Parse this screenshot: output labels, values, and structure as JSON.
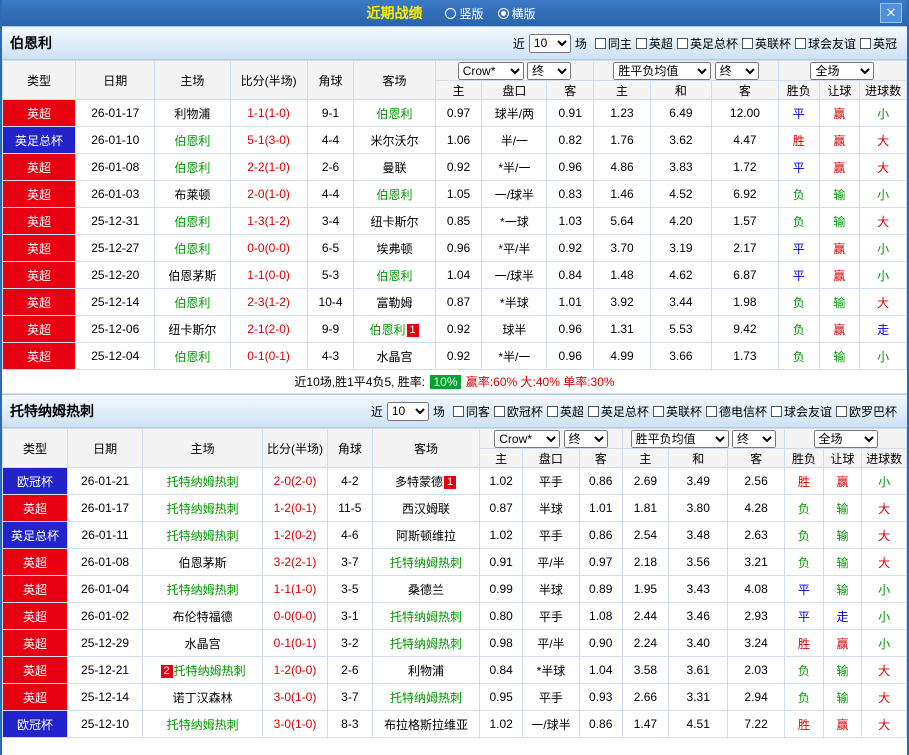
{
  "topbar": {
    "title": "近期战绩",
    "radios": [
      {
        "label": "竖版",
        "checked": false
      },
      {
        "label": "横版",
        "checked": true
      }
    ],
    "close_label": "✕"
  },
  "colors": {
    "accent_blue": "#2d6ab4",
    "league_red": "#e60012",
    "cup_blue": "#2323cc",
    "team_green": "#009900",
    "score_red": "#dd0000",
    "result_red": "#dd0000",
    "result_blue": "#0000e0",
    "result_green": "#009900",
    "rate_badge_green": "#00a32e"
  },
  "comp_colors": {
    "英超": "#e60012",
    "英足总杯": "#2323cc",
    "欧冠杯": "#2323cc"
  },
  "result_colors": {
    "胜": "#dd0000",
    "赢": "#dd0000",
    "大": "#dd0000",
    "平": "#0000e0",
    "走": "#0000e0",
    "负": "#009900",
    "输": "#009900",
    "小": "#009900"
  },
  "sections": [
    {
      "team": "伯恩利",
      "filter": {
        "prefix": "近",
        "count": "10",
        "suffix": "场",
        "options": [
          "同主",
          "英超",
          "英足总杯",
          "英联杯",
          "球会友谊",
          "英冠"
        ]
      },
      "columns": [
        "类型",
        "日期",
        "主场",
        "比分(半场)",
        "角球",
        "客场"
      ],
      "selects": {
        "bookmaker": "Crow*",
        "final_a": "终",
        "avg": "胜平负均值",
        "final_e": "终",
        "scope": "全场"
      },
      "subcolumns": [
        "主",
        "盘口",
        "客",
        "主",
        "和",
        "客",
        "胜负",
        "让球",
        "进球数"
      ],
      "rows": [
        {
          "comp": "英超",
          "date": "26-01-17",
          "home": {
            "name": "利物浦"
          },
          "score": "1-1(1-0)",
          "corners": "9-1",
          "away": {
            "name": "伯恩利",
            "highlight": true
          },
          "asian": [
            "0.97",
            "球半/两",
            "0.91"
          ],
          "euro": [
            "1.23",
            "6.49",
            "12.00"
          ],
          "results": [
            "平",
            "赢",
            "小"
          ]
        },
        {
          "comp": "英足总杯",
          "date": "26-01-10",
          "home": {
            "name": "伯恩利",
            "highlight": true
          },
          "score": "5-1(3-0)",
          "corners": "4-4",
          "away": {
            "name": "米尔沃尔"
          },
          "asian": [
            "1.06",
            "半/一",
            "0.82"
          ],
          "euro": [
            "1.76",
            "3.62",
            "4.47"
          ],
          "results": [
            "胜",
            "赢",
            "大"
          ]
        },
        {
          "comp": "英超",
          "date": "26-01-08",
          "home": {
            "name": "伯恩利",
            "highlight": true
          },
          "score": "2-2(1-0)",
          "corners": "2-6",
          "away": {
            "name": "曼联"
          },
          "asian": [
            "0.92",
            "*半/一",
            "0.96"
          ],
          "euro": [
            "4.86",
            "3.83",
            "1.72"
          ],
          "results": [
            "平",
            "赢",
            "大"
          ]
        },
        {
          "comp": "英超",
          "date": "26-01-03",
          "home": {
            "name": "布莱顿"
          },
          "score": "2-0(1-0)",
          "corners": "4-4",
          "away": {
            "name": "伯恩利",
            "highlight": true
          },
          "asian": [
            "1.05",
            "一/球半",
            "0.83"
          ],
          "euro": [
            "1.46",
            "4.52",
            "6.92"
          ],
          "results": [
            "负",
            "输",
            "小"
          ]
        },
        {
          "comp": "英超",
          "date": "25-12-31",
          "home": {
            "name": "伯恩利",
            "highlight": true
          },
          "score": "1-3(1-2)",
          "corners": "3-4",
          "away": {
            "name": "纽卡斯尔"
          },
          "asian": [
            "0.85",
            "*一球",
            "1.03"
          ],
          "euro": [
            "5.64",
            "4.20",
            "1.57"
          ],
          "results": [
            "负",
            "输",
            "大"
          ]
        },
        {
          "comp": "英超",
          "date": "25-12-27",
          "home": {
            "name": "伯恩利",
            "highlight": true
          },
          "score": "0-0(0-0)",
          "corners": "6-5",
          "away": {
            "name": "埃弗顿"
          },
          "asian": [
            "0.96",
            "*平/半",
            "0.92"
          ],
          "euro": [
            "3.70",
            "3.19",
            "2.17"
          ],
          "results": [
            "平",
            "赢",
            "小"
          ]
        },
        {
          "comp": "英超",
          "date": "25-12-20",
          "home": {
            "name": "伯恩茅斯"
          },
          "score": "1-1(0-0)",
          "corners": "5-3",
          "away": {
            "name": "伯恩利",
            "highlight": true
          },
          "asian": [
            "1.04",
            "一/球半",
            "0.84"
          ],
          "euro": [
            "1.48",
            "4.62",
            "6.87"
          ],
          "results": [
            "平",
            "赢",
            "小"
          ]
        },
        {
          "comp": "英超",
          "date": "25-12-14",
          "home": {
            "name": "伯恩利",
            "highlight": true
          },
          "score": "2-3(1-2)",
          "corners": "10-4",
          "away": {
            "name": "富勒姆"
          },
          "asian": [
            "0.87",
            "*半球",
            "1.01"
          ],
          "euro": [
            "3.92",
            "3.44",
            "1.98"
          ],
          "results": [
            "负",
            "输",
            "大"
          ]
        },
        {
          "comp": "英超",
          "date": "25-12-06",
          "home": {
            "name": "纽卡斯尔"
          },
          "score": "2-1(2-0)",
          "corners": "9-9",
          "away": {
            "name": "伯恩利",
            "highlight": true,
            "badge": "1",
            "badge_side": "right"
          },
          "asian": [
            "0.92",
            "球半",
            "0.96"
          ],
          "euro": [
            "1.31",
            "5.53",
            "9.42"
          ],
          "results": [
            "负",
            "赢",
            "走"
          ]
        },
        {
          "comp": "英超",
          "date": "25-12-04",
          "home": {
            "name": "伯恩利",
            "highlight": true
          },
          "score": "0-1(0-1)",
          "corners": "4-3",
          "away": {
            "name": "水晶宫"
          },
          "asian": [
            "0.92",
            "*半/一",
            "0.96"
          ],
          "euro": [
            "4.99",
            "3.66",
            "1.73"
          ],
          "results": [
            "负",
            "输",
            "小"
          ]
        }
      ],
      "summary": {
        "parts": [
          {
            "text": "近10场,胜1平4负5, 胜率: ",
            "cls": "",
            "name": "summary-record"
          },
          {
            "text": "10%",
            "cls": "badge-green",
            "name": "win-rate-badge"
          },
          {
            "text": " 赢率:60%",
            "cls": "red",
            "name": "handicap-win-rate"
          },
          {
            "text": " 大:40%",
            "cls": "red",
            "name": "over-rate"
          },
          {
            "text": " 单率:30%",
            "cls": "red",
            "name": "odd-rate"
          }
        ]
      }
    },
    {
      "team": "托特纳姆热刺",
      "filter": {
        "prefix": "近",
        "count": "10",
        "suffix": "场",
        "options": [
          "同客",
          "欧冠杯",
          "英超",
          "英足总杯",
          "英联杯",
          "德电信杯",
          "球会友谊",
          "欧罗巴杯"
        ]
      },
      "columns": [
        "类型",
        "日期",
        "主场",
        "比分(半场)",
        "角球",
        "客场"
      ],
      "selects": {
        "bookmaker": "Crow*",
        "final_a": "终",
        "avg": "胜平负均值",
        "final_e": "终",
        "scope": "全场"
      },
      "subcolumns": [
        "主",
        "盘口",
        "客",
        "主",
        "和",
        "客",
        "胜负",
        "让球",
        "进球数"
      ],
      "rows": [
        {
          "comp": "欧冠杯",
          "date": "26-01-21",
          "home": {
            "name": "托特纳姆热刺",
            "highlight": true
          },
          "score": "2-0(2-0)",
          "corners": "4-2",
          "away": {
            "name": "多特蒙德",
            "badge": "1",
            "badge_side": "right"
          },
          "asian": [
            "1.02",
            "平手",
            "0.86"
          ],
          "euro": [
            "2.69",
            "3.49",
            "2.56"
          ],
          "results": [
            "胜",
            "赢",
            "小"
          ]
        },
        {
          "comp": "英超",
          "date": "26-01-17",
          "home": {
            "name": "托特纳姆热刺",
            "highlight": true
          },
          "score": "1-2(0-1)",
          "corners": "11-5",
          "away": {
            "name": "西汉姆联"
          },
          "asian": [
            "0.87",
            "半球",
            "1.01"
          ],
          "euro": [
            "1.81",
            "3.80",
            "4.28"
          ],
          "results": [
            "负",
            "输",
            "大"
          ]
        },
        {
          "comp": "英足总杯",
          "date": "26-01-11",
          "home": {
            "name": "托特纳姆热刺",
            "highlight": true
          },
          "score": "1-2(0-2)",
          "corners": "4-6",
          "away": {
            "name": "阿斯顿维拉"
          },
          "asian": [
            "1.02",
            "平手",
            "0.86"
          ],
          "euro": [
            "2.54",
            "3.48",
            "2.63"
          ],
          "results": [
            "负",
            "输",
            "大"
          ]
        },
        {
          "comp": "英超",
          "date": "26-01-08",
          "home": {
            "name": "伯恩茅斯"
          },
          "score": "3-2(2-1)",
          "corners": "3-7",
          "away": {
            "name": "托特纳姆热刺",
            "highlight": true
          },
          "asian": [
            "0.91",
            "平/半",
            "0.97"
          ],
          "euro": [
            "2.18",
            "3.56",
            "3.21"
          ],
          "results": [
            "负",
            "输",
            "大"
          ]
        },
        {
          "comp": "英超",
          "date": "26-01-04",
          "home": {
            "name": "托特纳姆热刺",
            "highlight": true
          },
          "score": "1-1(1-0)",
          "corners": "3-5",
          "away": {
            "name": "桑德兰"
          },
          "asian": [
            "0.99",
            "半球",
            "0.89"
          ],
          "euro": [
            "1.95",
            "3.43",
            "4.08"
          ],
          "results": [
            "平",
            "输",
            "小"
          ]
        },
        {
          "comp": "英超",
          "date": "26-01-02",
          "home": {
            "name": "布伦特福德"
          },
          "score": "0-0(0-0)",
          "corners": "3-1",
          "away": {
            "name": "托特纳姆热刺",
            "highlight": true
          },
          "asian": [
            "0.80",
            "平手",
            "1.08"
          ],
          "euro": [
            "2.44",
            "3.46",
            "2.93"
          ],
          "results": [
            "平",
            "走",
            "小"
          ]
        },
        {
          "comp": "英超",
          "date": "25-12-29",
          "home": {
            "name": "水晶宫"
          },
          "score": "0-1(0-1)",
          "corners": "3-2",
          "away": {
            "name": "托特纳姆热刺",
            "highlight": true
          },
          "asian": [
            "0.98",
            "平/半",
            "0.90"
          ],
          "euro": [
            "2.24",
            "3.40",
            "3.24"
          ],
          "results": [
            "胜",
            "赢",
            "小"
          ]
        },
        {
          "comp": "英超",
          "date": "25-12-21",
          "home": {
            "name": "托特纳姆热刺",
            "highlight": true,
            "badge": "2",
            "badge_side": "left"
          },
          "score": "1-2(0-0)",
          "corners": "2-6",
          "away": {
            "name": "利物浦"
          },
          "asian": [
            "0.84",
            "*半球",
            "1.04"
          ],
          "euro": [
            "3.58",
            "3.61",
            "2.03"
          ],
          "results": [
            "负",
            "输",
            "大"
          ]
        },
        {
          "comp": "英超",
          "date": "25-12-14",
          "home": {
            "name": "诺丁汉森林"
          },
          "score": "3-0(1-0)",
          "corners": "3-7",
          "away": {
            "name": "托特纳姆热刺",
            "highlight": true
          },
          "asian": [
            "0.95",
            "平手",
            "0.93"
          ],
          "euro": [
            "2.66",
            "3.31",
            "2.94"
          ],
          "results": [
            "负",
            "输",
            "大"
          ]
        },
        {
          "comp": "欧冠杯",
          "date": "25-12-10",
          "home": {
            "name": "托特纳姆热刺",
            "highlight": true
          },
          "score": "3-0(1-0)",
          "corners": "8-3",
          "away": {
            "name": "布拉格斯拉维亚"
          },
          "asian": [
            "1.02",
            "一/球半",
            "0.86"
          ],
          "euro": [
            "1.47",
            "4.51",
            "7.22"
          ],
          "results": [
            "胜",
            "赢",
            "大"
          ]
        }
      ],
      "summary": null
    }
  ]
}
